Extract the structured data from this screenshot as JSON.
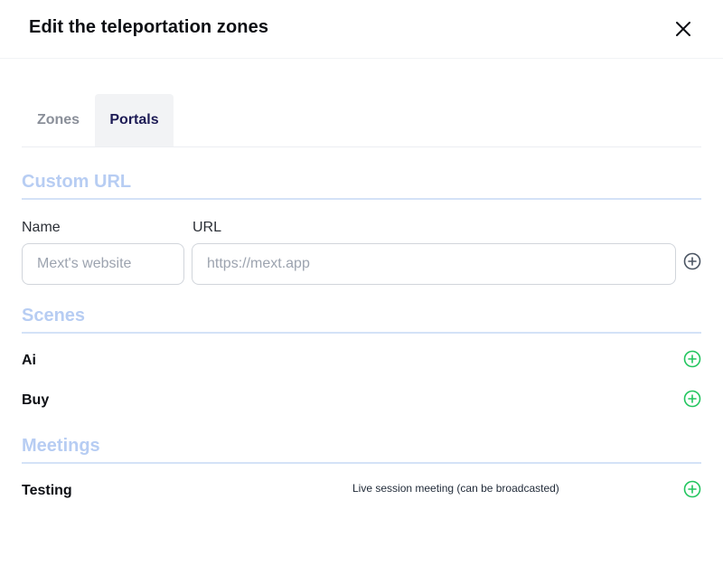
{
  "dialog": {
    "title": "Edit the teleportation zones"
  },
  "tabs": [
    {
      "label": "Zones",
      "active": false
    },
    {
      "label": "Portals",
      "active": true
    }
  ],
  "custom_url": {
    "heading": "Custom URL",
    "name_label": "Name",
    "name_placeholder": "Mext's website",
    "name_value": "",
    "url_label": "URL",
    "url_placeholder": "https://mext.app",
    "url_value": ""
  },
  "scenes": {
    "heading": "Scenes",
    "items": [
      {
        "label": "Ai"
      },
      {
        "label": "Buy"
      }
    ]
  },
  "meetings": {
    "heading": "Meetings",
    "items": [
      {
        "label": "Testing",
        "description": "Live session meeting (can be broadcasted)"
      }
    ]
  },
  "colors": {
    "accent_green": "#22c55e",
    "section_heading": "#b7cdf3",
    "active_tab_text": "#1d1b55"
  },
  "icons": {
    "close": "close-icon",
    "add_url": "plus-circle-icon",
    "add_item": "plus-circle-icon"
  }
}
